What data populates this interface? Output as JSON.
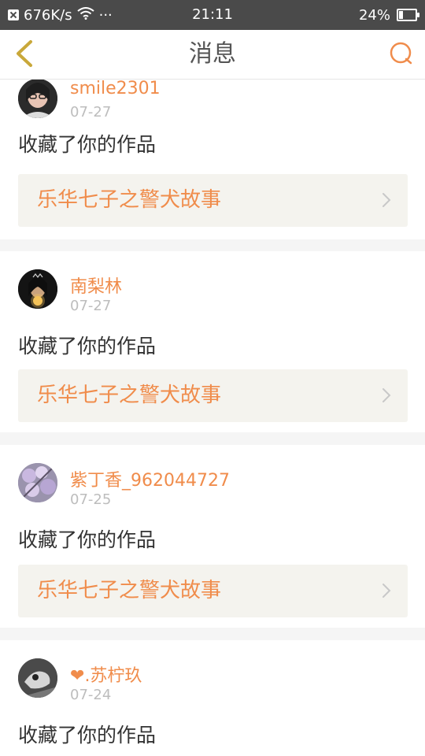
{
  "status_bar": {
    "network_speed": "676K/s",
    "dots": "···",
    "time": "21:11",
    "battery_percent": "24%",
    "battery_level": 0.24
  },
  "nav": {
    "title": "消息",
    "back_icon": "chevron-left-icon",
    "search_icon": "search-icon"
  },
  "colors": {
    "accent": "#f08c4b",
    "status_bar_bg": "#4a4a4a",
    "work_bg": "#f4f3ee",
    "date": "#bdbdbd"
  },
  "notifications": [
    {
      "username": "smile2301",
      "date": "07-27",
      "action": "收藏了你的作品",
      "work_title": "乐华七子之警犬故事"
    },
    {
      "username": "南梨林",
      "date": "07-27",
      "action": "收藏了你的作品",
      "work_title": "乐华七子之警犬故事"
    },
    {
      "username": "紫丁香_962044727",
      "date": "07-25",
      "action": "收藏了你的作品",
      "work_title": "乐华七子之警犬故事"
    },
    {
      "username_heart": "❤",
      "username": ".苏柠玖",
      "date": "07-24",
      "action": "收藏了你的作品"
    }
  ]
}
